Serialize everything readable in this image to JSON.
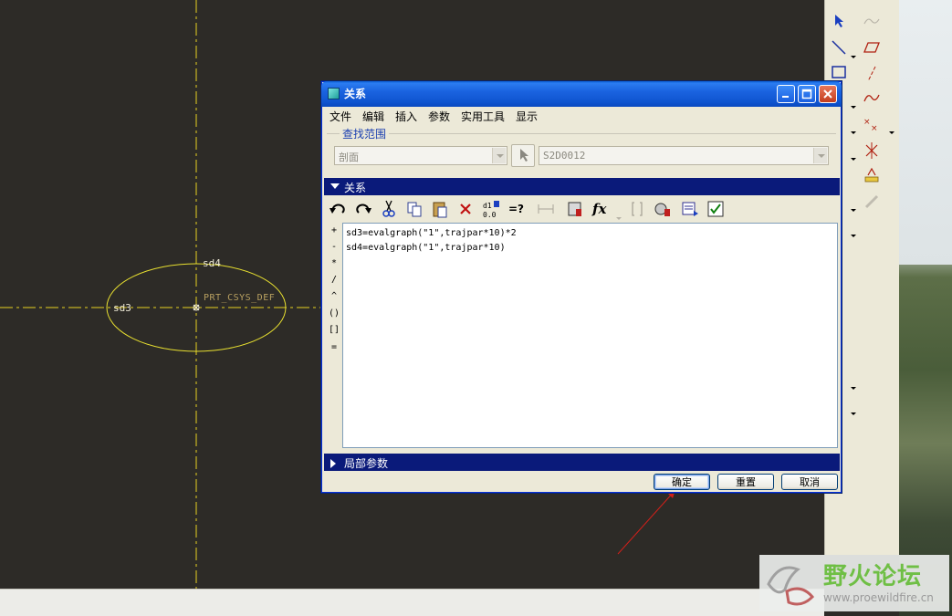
{
  "sketch": {
    "dim_sd4": "sd4",
    "dim_sd3": "sd3",
    "csys_label": "PRT_CSYS_DEF",
    "colors": {
      "background": "#2d2b27",
      "centerline": "#e8d020",
      "sketch": "#e8e030"
    }
  },
  "dialog": {
    "title": "关系",
    "menu": [
      "文件",
      "编辑",
      "插入",
      "参数",
      "实用工具",
      "显示"
    ],
    "scope_title": "查找范围",
    "scope_type": "剖面",
    "scope_entity": "S2D0012",
    "section_relations": "关系",
    "section_local_params": "局部参数",
    "operators": [
      "+",
      "-",
      "*",
      "/",
      "^",
      "()",
      "[]",
      "="
    ],
    "relations": [
      "sd3=evalgraph(\"1\",trajpar*10)*2",
      "sd4=evalgraph(\"1\",trajpar*10)"
    ],
    "buttons": {
      "ok": "确定",
      "reset": "重置",
      "cancel": "取消"
    },
    "toolbar_icons": [
      "undo-icon",
      "redo-icon",
      "cut-icon",
      "copy-icon",
      "paste-icon",
      "delete-icon",
      "evaluate-icon",
      "equals-question-icon",
      "dimension-icon",
      "parameter-icon",
      "function-icon",
      "bracket-icon",
      "sort-icon",
      "units-icon",
      "verify-icon"
    ]
  },
  "watermark": {
    "name": "野火论坛",
    "url": "www.proewildfire.cn"
  }
}
